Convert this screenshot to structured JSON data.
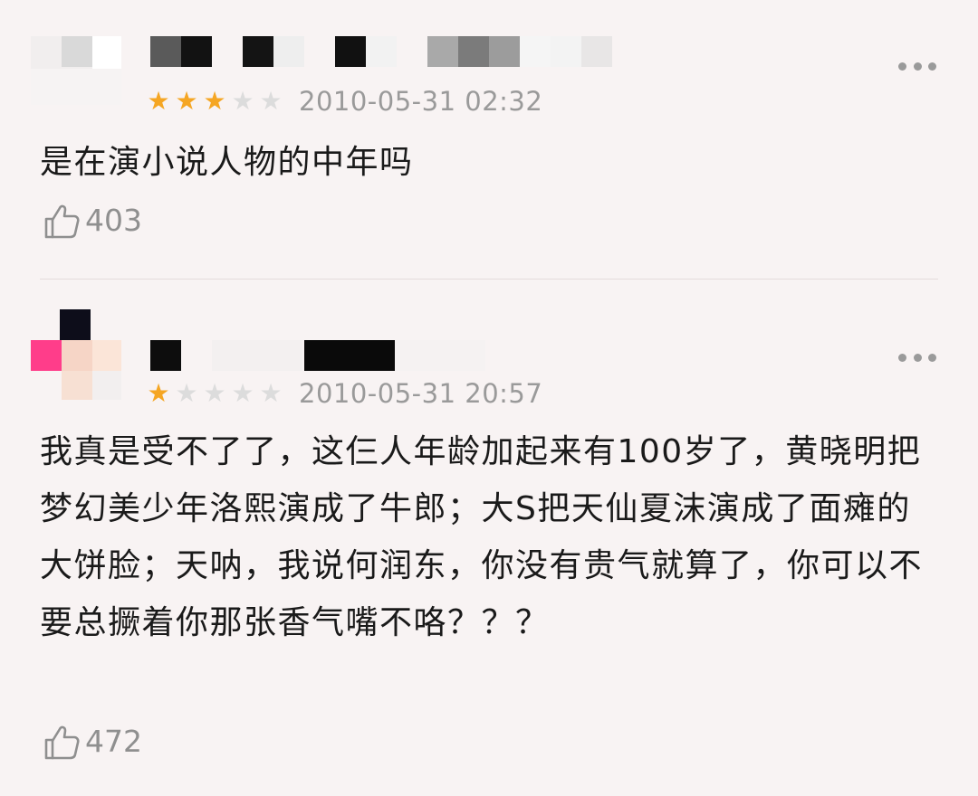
{
  "comments": [
    {
      "rating": 3,
      "max_rating": 5,
      "timestamp": "2010-05-31 02:32",
      "text": "是在演小说人物的中年吗",
      "likes": "403",
      "icons": {
        "more": "more-dots-icon",
        "like": "thumbs-up-icon",
        "star": "star-icon"
      }
    },
    {
      "rating": 1,
      "max_rating": 5,
      "timestamp": "2010-05-31 20:57",
      "text": "我真是受不了了，这仨人年龄加起来有100岁了，黄晓明把梦幻美少年洛熙演成了牛郎；大S把天仙夏沫演成了面瘫的大饼脸；天呐，我说何润东，你没有贵气就算了，你可以不要总撅着你那张香气嘴不咯？？？",
      "likes": "472",
      "icons": {
        "more": "more-dots-icon",
        "like": "thumbs-up-icon",
        "star": "star-icon"
      }
    }
  ],
  "colors": {
    "background": "#f8f3f3",
    "star_active": "#f5a623",
    "star_inactive": "#dcdcdc",
    "meta_text": "#9a9a9a",
    "body_text": "#1a1a1a",
    "divider": "#e4dcdc"
  }
}
